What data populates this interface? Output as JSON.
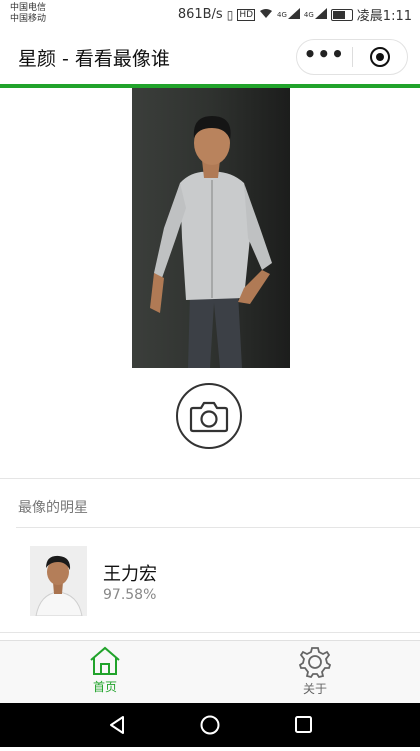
{
  "status_bar": {
    "carrier_1": "中国电信",
    "carrier_2": "中国移动",
    "speed": "861B/s",
    "net_1": "4G",
    "net_2": "4G",
    "time": "凌晨1:11"
  },
  "nav": {
    "title": "星颜 - 看看最像谁",
    "more_icon": "more-dots-icon",
    "close_icon": "target-circle-icon"
  },
  "main": {
    "camera_icon": "camera-icon",
    "section_title": "最像的明星"
  },
  "result": {
    "name": "王力宏",
    "score": "97.58%"
  },
  "tabs": [
    {
      "label": "首页",
      "icon": "home-icon",
      "active": true
    },
    {
      "label": "关于",
      "icon": "gear-icon",
      "active": false
    }
  ],
  "colors": {
    "accent": "#21a32b",
    "inactive": "#666666"
  }
}
